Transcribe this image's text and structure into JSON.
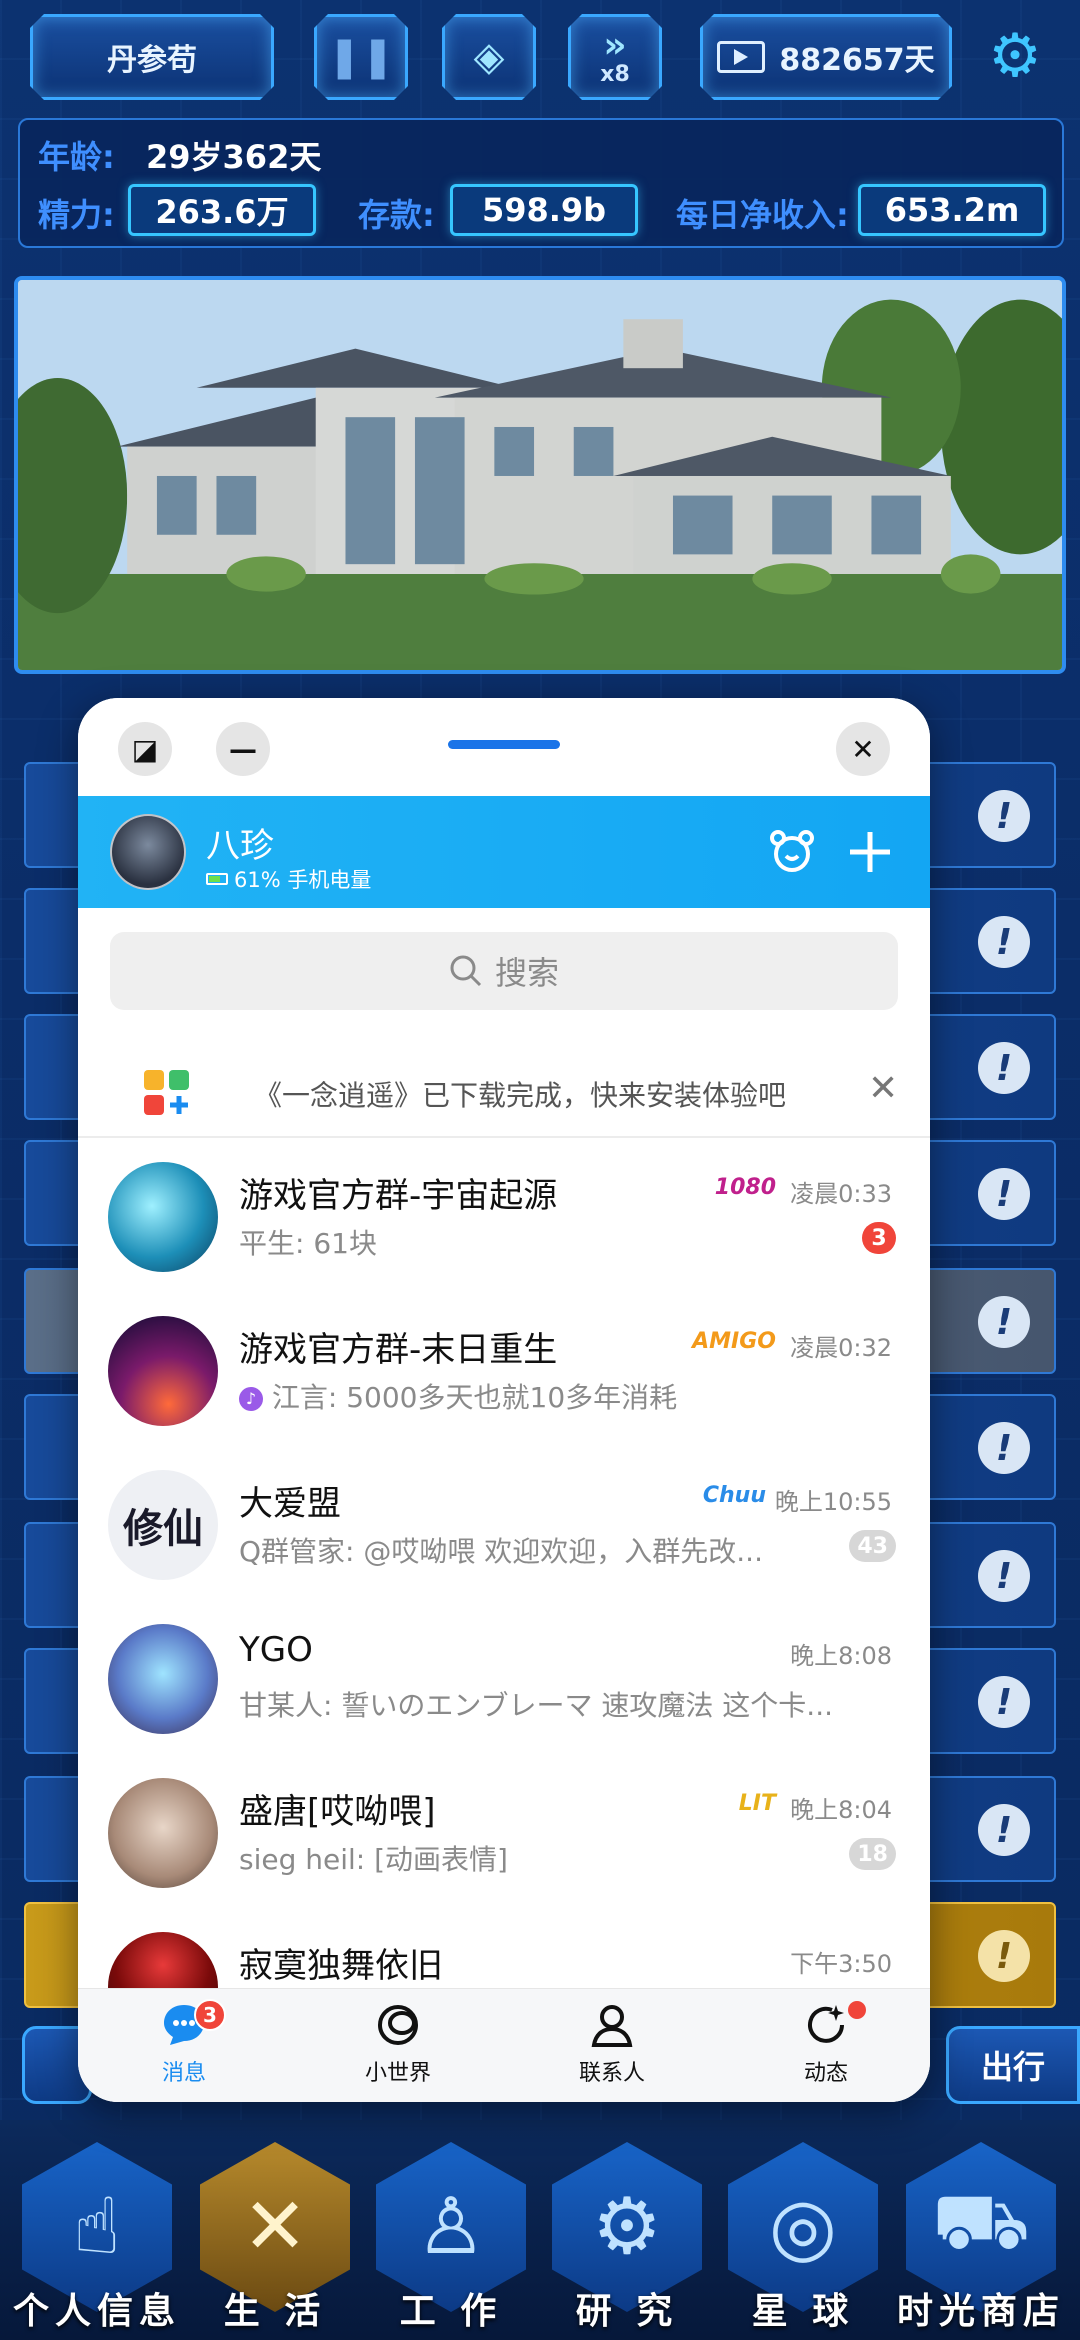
{
  "game": {
    "player_name": "丹参苟",
    "speed_label": "x8",
    "days_value": "882657天",
    "stats": {
      "age_label": "年龄:",
      "age_value": "29岁362天",
      "energy_label": "精力:",
      "energy_value": "263.6万",
      "savings_label": "存款:",
      "savings_value": "598.9b",
      "income_label": "每日净收入:",
      "income_value": "653.2m"
    },
    "go_button": "出行",
    "bottom_nav": [
      {
        "label": "个人信息",
        "icon": "fingerprint-icon"
      },
      {
        "label": "生 活",
        "icon": "fork-knife-icon"
      },
      {
        "label": "工 作",
        "icon": "worker-icon"
      },
      {
        "label": "研 究",
        "icon": "dna-gear-icon"
      },
      {
        "label": "星 球",
        "icon": "globe-icon"
      },
      {
        "label": "时光商店",
        "icon": "cart-icon"
      }
    ],
    "nav_active": 1
  },
  "popup": {
    "header": {
      "name": "八珍",
      "battery_text": "61% 手机电量"
    },
    "search": {
      "placeholder": "搜索"
    },
    "notice": {
      "text": "《一念逍遥》已下载完成，快来安装体验吧"
    },
    "chats": [
      {
        "title": "游戏官方群-宇宙起源",
        "preview": "平生: 61块",
        "time": "凌晨0:33",
        "badge": "3",
        "badge_style": "red",
        "tag": "1080",
        "tag_color": "#c0208c"
      },
      {
        "title": "游戏官方群-末日重生",
        "preview": "江言: 5000多天也就10多年消耗",
        "time": "凌晨0:32",
        "badge": "",
        "badge_style": "",
        "tag": "AMIGO",
        "tag_color": "#f39a1a"
      },
      {
        "title": "大爱盟",
        "preview": "Q群管家: @哎呦喂 欢迎欢迎，入群先改...",
        "time": "晚上10:55",
        "badge": "43",
        "badge_style": "grey",
        "tag": "Chuu",
        "tag_color": "#2a8ce8"
      },
      {
        "title": "YGO",
        "preview": "甘某人: 誓いのエンブレーマ 速攻魔法 这个卡...",
        "time": "晚上8:08",
        "badge": "",
        "badge_style": "",
        "tag": "",
        "tag_color": ""
      },
      {
        "title": "盛唐[哎呦喂]",
        "preview": "sieg heil: [动画表情]",
        "time": "晚上8:04",
        "badge": "18",
        "badge_style": "grey",
        "tag": "LIT",
        "tag_color": "#e8b21a"
      },
      {
        "title": "寂寞独舞依旧",
        "preview": "",
        "time": "下午3:50",
        "badge": "",
        "badge_style": "",
        "tag": "",
        "tag_color": ""
      }
    ],
    "tabs": [
      {
        "label": "消息",
        "badge": "3"
      },
      {
        "label": "小世界",
        "badge": ""
      },
      {
        "label": "联系人",
        "badge": ""
      },
      {
        "label": "动态",
        "badge": ""
      }
    ]
  }
}
